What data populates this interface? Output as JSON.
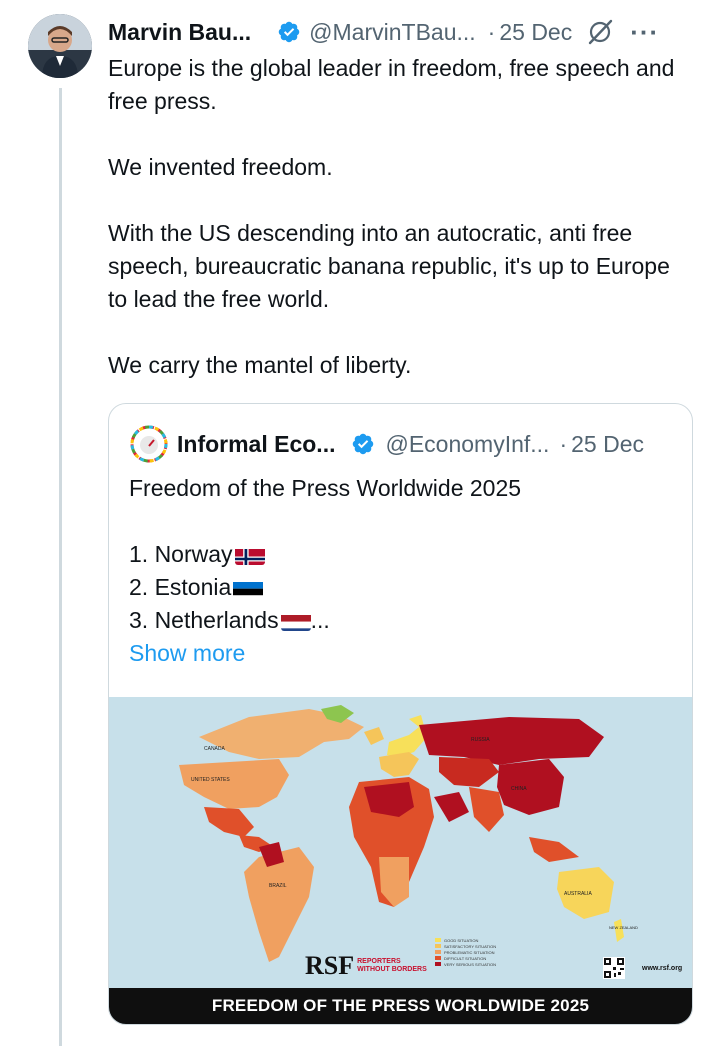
{
  "tweet": {
    "author_name": "Marvin Bau...",
    "author_handle": "@MarvinTBau...",
    "separator": "·",
    "date": "25 Dec",
    "more_label": "···",
    "text": "Europe is the global leader in freedom, free speech and free press.\n\nWe invented freedom.\n\nWith the US descending into an autocratic, anti free speech, bureaucratic banana republic, it's up to Europe to lead the free world.\n\nWe carry the mantel of liberty."
  },
  "quote": {
    "author_name": "Informal Eco...",
    "author_handle": "@EconomyInf...",
    "separator": "·",
    "date": "25 Dec",
    "title": "Freedom of the Press Worldwide 2025",
    "list": [
      "1. Norway",
      "2. Estonia",
      "3. Netherlands"
    ],
    "truncation": "...",
    "show_more": "Show more"
  },
  "map": {
    "banner": "FREEDOM OF THE PRESS WORLDWIDE 2025",
    "rsf_mark": "RSF",
    "rsf_name_1": "REPORTERS",
    "rsf_name_2": "WITHOUT BORDERS",
    "website": "www.rsf.org",
    "legend": [
      {
        "label": "GOOD SITUATION",
        "color": "#f7e05a"
      },
      {
        "label": "SATISFACTORY SITUATION",
        "color": "#f5c55a"
      },
      {
        "label": "PROBLEMATIC SITUATION",
        "color": "#f0a060"
      },
      {
        "label": "DIFFICULT SITUATION",
        "color": "#e0502a"
      },
      {
        "label": "VERY SERIOUS SITUATION",
        "color": "#b01020"
      }
    ],
    "labels": {
      "canada": "CANADA",
      "us": "UNITED STATES",
      "brazil": "BRAZIL",
      "russia": "RUSSIA",
      "china": "CHINA",
      "australia": "AUSTRALIA",
      "new_zealand": "NEW ZEALAND"
    }
  },
  "colors": {
    "accent": "#1d9bf0",
    "secondary_text": "#536471",
    "border": "#cfd9de"
  }
}
